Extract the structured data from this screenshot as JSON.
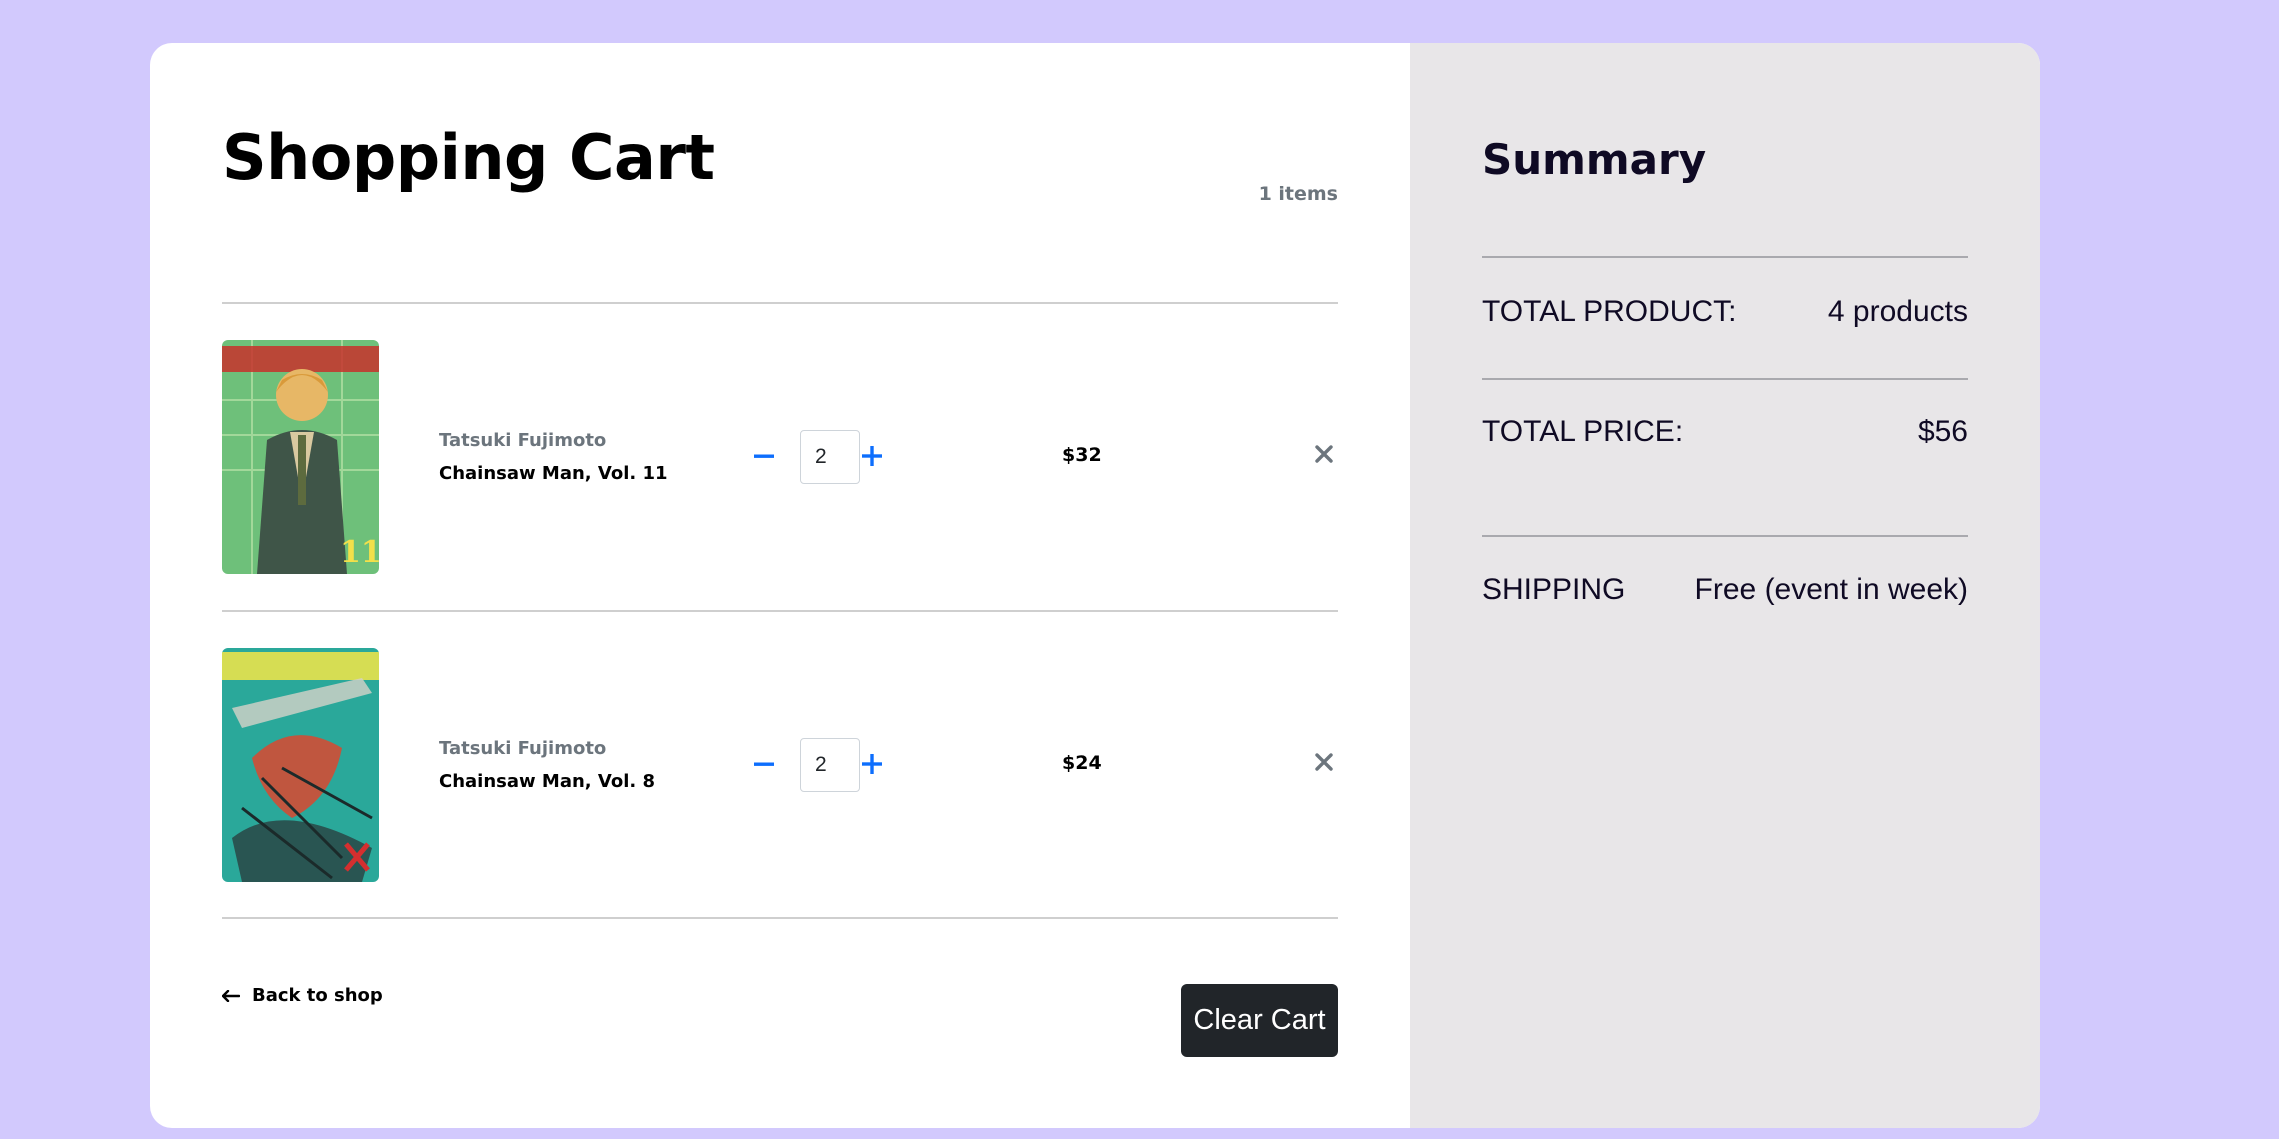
{
  "cart": {
    "title": "Shopping Cart",
    "item_count": "1 items",
    "items": [
      {
        "author": "Tatsuki Fujimoto",
        "title": "Chainsaw Man, Vol. 11",
        "quantity": "2",
        "price": "$32",
        "cover_colors": [
          "#6ec07a",
          "#3f6f4e",
          "#e7b766"
        ]
      },
      {
        "author": "Tatsuki Fujimoto",
        "title": "Chainsaw Man, Vol. 8",
        "quantity": "2",
        "price": "$24",
        "cover_colors": [
          "#2aa89a",
          "#1b6f66",
          "#c0563f"
        ]
      }
    ],
    "back_label": "Back to shop",
    "clear_label": "Clear Cart"
  },
  "summary": {
    "title": "Summary",
    "total_product_label": "TOTAL PRODUCT:",
    "total_product_value": "4 products",
    "total_price_label": "TOTAL PRICE:",
    "total_price_value": "$56",
    "shipping_label": "SHIPPING",
    "shipping_value": "Free (event in week)"
  },
  "colors": {
    "background": "#d2c9fd",
    "accent": "#0d6efd",
    "button_dark": "#212529",
    "muted_text": "#6c757d",
    "summary_bg": "#e8e6e8"
  }
}
